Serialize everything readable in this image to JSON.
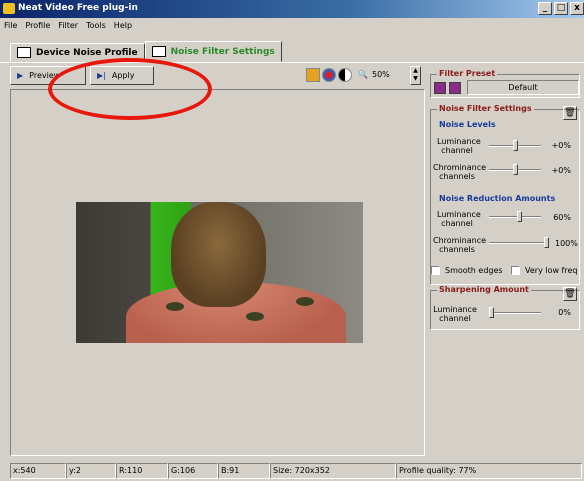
{
  "window": {
    "title": "Neat Video Free plug-in",
    "buttons": [
      "_",
      "□",
      "x"
    ]
  },
  "menu": [
    "File",
    "Profile",
    "Filter",
    "Tools",
    "Help"
  ],
  "tabs": [
    {
      "label": "Device Noise Profile",
      "active": false
    },
    {
      "label": "Noise Filter Settings",
      "active": true
    }
  ],
  "toolbar": {
    "preview_label": "Preview",
    "apply_label": "Apply",
    "zoom": "50%"
  },
  "filter_preset": {
    "title": "Filter Preset",
    "selected": "Default"
  },
  "noise_filter_settings": {
    "title": "Noise Filter Settings",
    "noise_levels": {
      "title": "Noise Levels",
      "rows": [
        {
          "label": "Luminance channel",
          "value": "+0%",
          "level": 0.5
        },
        {
          "label": "Chrominance channels",
          "value": "+0%",
          "level": 0.5
        }
      ]
    },
    "noise_reduction": {
      "title": "Noise Reduction Amounts",
      "rows": [
        {
          "label": "Luminance channel",
          "value": "60%",
          "level": 0.6
        },
        {
          "label": "Chrominance channels",
          "value": "100%",
          "level": 1.0
        }
      ]
    },
    "smooth_edges_label": "Smooth edges",
    "very_low_freq_label": "Very low freq"
  },
  "sharpening": {
    "title": "Sharpening Amount",
    "rows": [
      {
        "label": "Luminance channel",
        "value": "0%",
        "level": 0.0
      }
    ]
  },
  "status": {
    "x": "x:540",
    "y": "y:2",
    "r": "R:110",
    "g": "G:106",
    "b": "B:91",
    "size": "Size: 720x352",
    "quality": "Profile quality: 77%"
  },
  "colors": {
    "annotation": "#e8170c",
    "green_tab": "#2a8a2a",
    "section_title": "#8b1a1a",
    "subsection_title": "#1a3a9a"
  }
}
